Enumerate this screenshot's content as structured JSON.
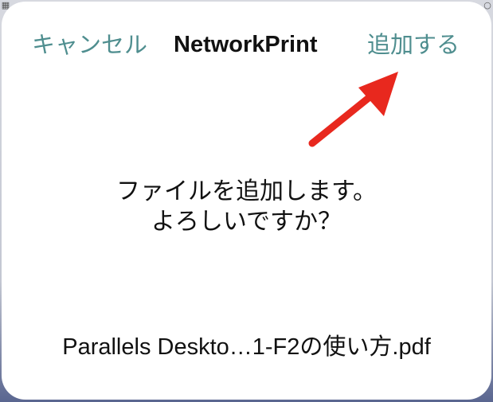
{
  "dialog": {
    "cancel_label": "キャンセル",
    "title": "NetworkPrint",
    "add_label": "追加する",
    "message_line1": "ファイルを追加します。",
    "message_line2": "よろしいですか？",
    "filename": "Parallels Deskto…1-F2の使い方.pdf"
  },
  "colors": {
    "accent": "#4f8e8f",
    "arrow": "#e8281e",
    "text": "#111111",
    "background": "#ffffff"
  },
  "icons": {
    "annotation": "red-arrow-icon"
  }
}
